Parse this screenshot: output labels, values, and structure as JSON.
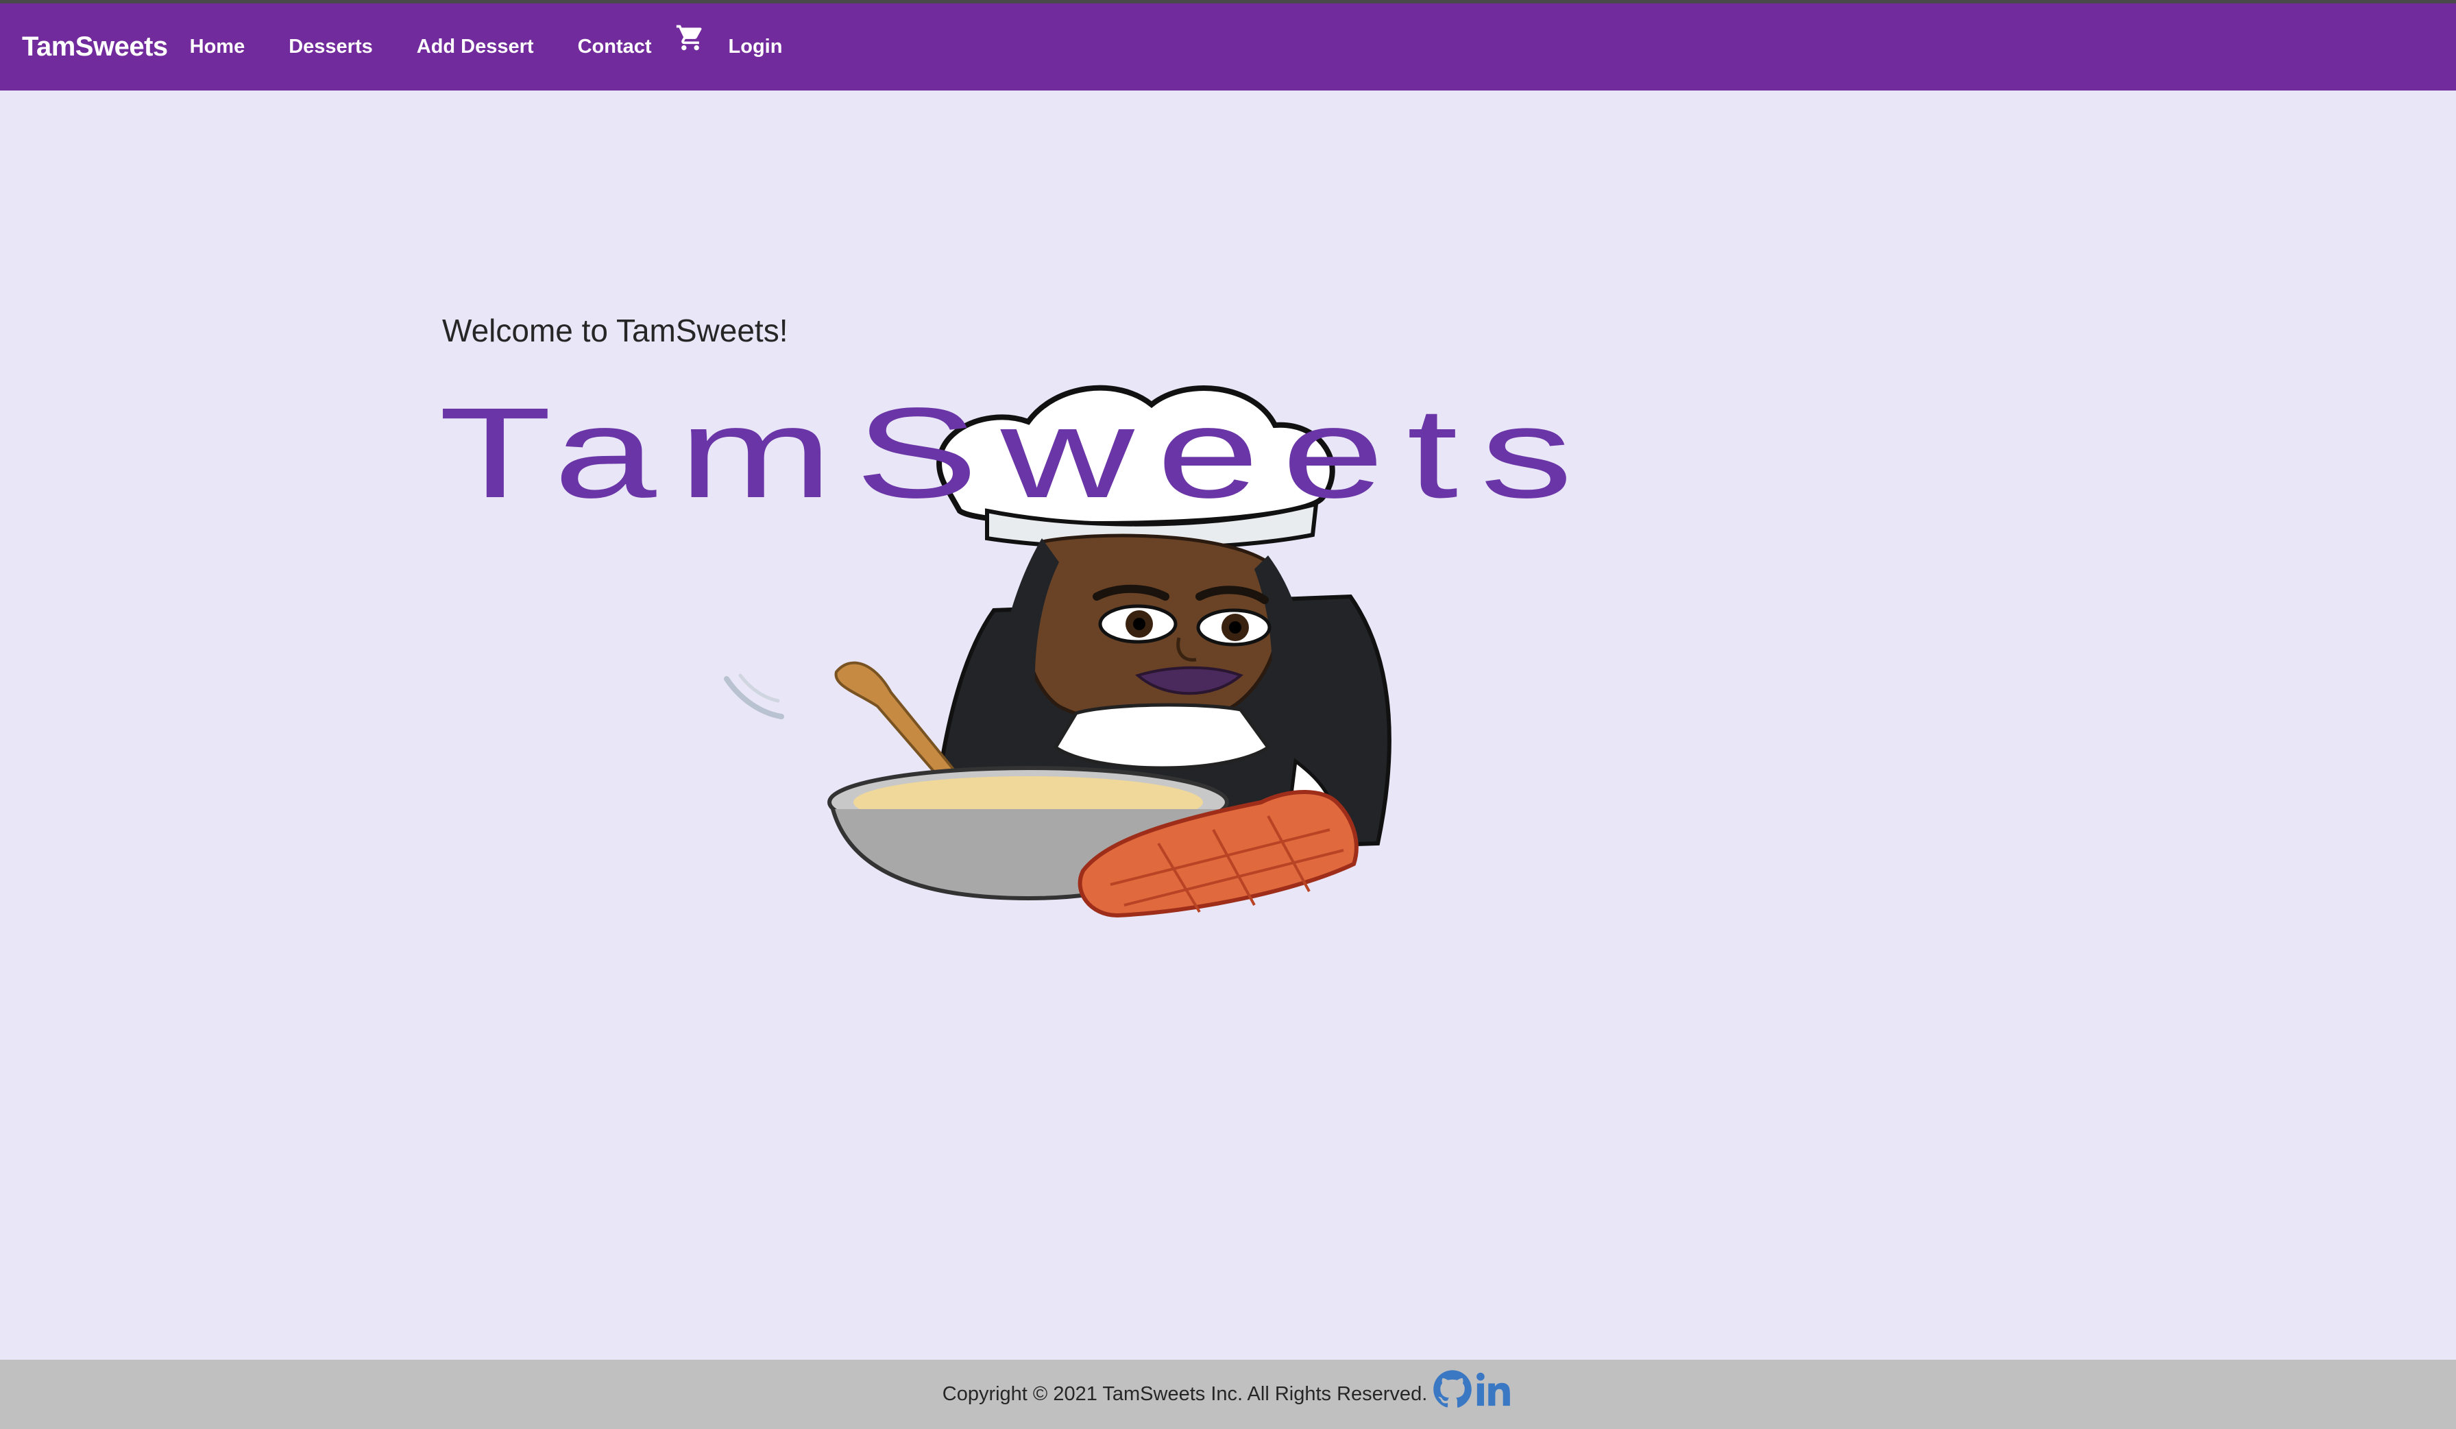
{
  "navbar": {
    "brand": "TamSweets",
    "links": [
      "Home",
      "Desserts",
      "Add Dessert",
      "Contact"
    ],
    "cart_icon": "shopping-cart-icon",
    "login": "Login",
    "color": "#722b9c"
  },
  "main": {
    "welcome": "Welcome to TamSweets!",
    "logo_text": "TamSweets",
    "logo_color": "#6a35a6",
    "background": "#e8e6f7"
  },
  "footer": {
    "copyright": "Copyright © 2021 TamSweets Inc. All Rights Reserved.",
    "icons": [
      "github-icon",
      "linkedin-icon"
    ],
    "icon_color": "#3b78c4"
  }
}
